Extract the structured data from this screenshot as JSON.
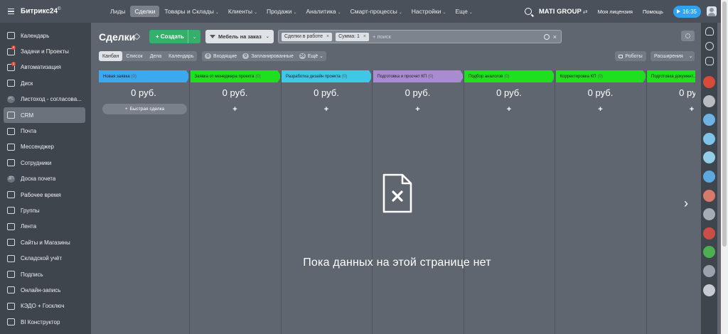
{
  "app": {
    "logo": "Битрикс24",
    "logo_mark": "©"
  },
  "topnav": {
    "items": [
      {
        "label": "Лиды",
        "dropdown": ""
      },
      {
        "label": "Сделки",
        "dropdown": "",
        "active": true
      },
      {
        "label": "Товары и Склады",
        "dropdown": "⌄"
      },
      {
        "label": "Клиенты",
        "dropdown": "⌄"
      },
      {
        "label": "Продажи",
        "dropdown": "⌄"
      },
      {
        "label": "Аналитика",
        "dropdown": "⌄"
      },
      {
        "label": "Смарт-процессы",
        "dropdown": "⌄"
      },
      {
        "label": "Настройки",
        "dropdown": "⌄"
      },
      {
        "label": "Еще",
        "dropdown": "⌄"
      }
    ],
    "company": "MATI GROUP",
    "company_switch": "⇄",
    "license": "Моя лицензия",
    "help": "Помощь",
    "time": "16:35"
  },
  "sidebar": {
    "items": [
      {
        "label": "Календарь",
        "icon": "calendar-icon",
        "badge": ""
      },
      {
        "label": "Задачи и Проекты",
        "icon": "tasks-icon",
        "badge": "4"
      },
      {
        "label": "Автоматизация",
        "icon": "automation-icon",
        "badge": "1"
      },
      {
        "label": "Диск",
        "icon": "disk-icon",
        "badge": ""
      },
      {
        "label": "Листоход - согласова...",
        "icon": "pc-icon",
        "glyph": "PC",
        "badge": ""
      },
      {
        "label": "CRM",
        "icon": "crm-icon",
        "badge": "",
        "active": true
      },
      {
        "label": "Почта",
        "icon": "mail-icon",
        "badge": ""
      },
      {
        "label": "Мессенджер",
        "icon": "messenger-icon",
        "badge": ""
      },
      {
        "label": "Сотрудники",
        "icon": "employees-icon",
        "badge": ""
      },
      {
        "label": "Доска почета",
        "icon": "honor-board-icon",
        "glyph": "ДП",
        "badge": ""
      },
      {
        "label": "Рабочее время",
        "icon": "clock-icon",
        "badge": ""
      },
      {
        "label": "Группы",
        "icon": "groups-icon",
        "badge": ""
      },
      {
        "label": "Лента",
        "icon": "feed-icon",
        "badge": ""
      },
      {
        "label": "Сайты и Магазины",
        "icon": "sites-icon",
        "badge": ""
      },
      {
        "label": "Складской учёт",
        "icon": "warehouse-icon",
        "badge": ""
      },
      {
        "label": "Подпись",
        "icon": "signature-icon",
        "badge": ""
      },
      {
        "label": "Онлайн-запись",
        "icon": "booking-icon",
        "badge": ""
      },
      {
        "label": "КЭДО + Госключ",
        "icon": "document-icon",
        "badge": ""
      },
      {
        "label": "BI Конструктор",
        "icon": "bi-icon",
        "badge": ""
      }
    ]
  },
  "toolbar": {
    "title": "Сделки",
    "create_label": "+ Создать",
    "create_dropdown": "⌄",
    "category_label": "Мебель на заказ",
    "category_dropdown": "⌄",
    "filter_chips": [
      {
        "label": "Сделки в работе",
        "close": "×"
      },
      {
        "label": "Сумма: 1",
        "close": "×"
      }
    ],
    "search_placeholder": "+ поиск",
    "clear": "×"
  },
  "subbar": {
    "views": [
      {
        "label": "Канбан",
        "active": true
      },
      {
        "label": "Список"
      },
      {
        "label": "Дела"
      },
      {
        "label": "Календарь"
      }
    ],
    "counters": [
      {
        "count": "0",
        "label": "Входящие"
      },
      {
        "count": "0",
        "label": "Запланированные"
      },
      {
        "count": "26",
        "label": "Ещё ⌄"
      }
    ],
    "robots_label": "Роботы",
    "extensions_label": "Расширения",
    "extensions_dropdown": "⌄"
  },
  "kanban": {
    "columns": [
      {
        "name": "Новая заявка",
        "count": "(0)",
        "color": "#3ba9f0",
        "sum": "0 руб.",
        "add": "+",
        "quick": "Быстрая сделка"
      },
      {
        "name": "Заявка от менеджера проекта",
        "count": "(0)",
        "color": "#1ee01e",
        "sum": "0 руб.",
        "add": "+"
      },
      {
        "name": "Разработка дизайн проекта",
        "count": "(0)",
        "color": "#3ec7e6",
        "sum": "0 руб.",
        "add": "+"
      },
      {
        "name": "Подготовка и просчет КП",
        "count": "(0)",
        "color": "#a98bd1",
        "sum": "0 руб.",
        "add": "+"
      },
      {
        "name": "Подбор аналогов",
        "count": "(0)",
        "color": "#1ee01e",
        "sum": "0 руб.",
        "add": "+"
      },
      {
        "name": "Корректировка КП",
        "count": "(0)",
        "color": "#1ee01e",
        "sum": "0 руб.",
        "add": "+"
      },
      {
        "name": "Подготовка документ...",
        "count": "",
        "color": "#1ee01e",
        "sum": "0 руб.",
        "add": "+"
      }
    ],
    "empty_text": "Пока данных на этой странице нет",
    "next": "›"
  },
  "rail": {
    "avatar_colors": [
      "#d84a3a",
      "#b9bcc1",
      "#6cb3e4",
      "#7fc2ea",
      "#93cde9",
      "#5aa9e0",
      "#d87a6a",
      "#a4adb6",
      "#c94f46",
      "#4caf50",
      "#9aa3ad",
      "#c6cbd1"
    ]
  }
}
